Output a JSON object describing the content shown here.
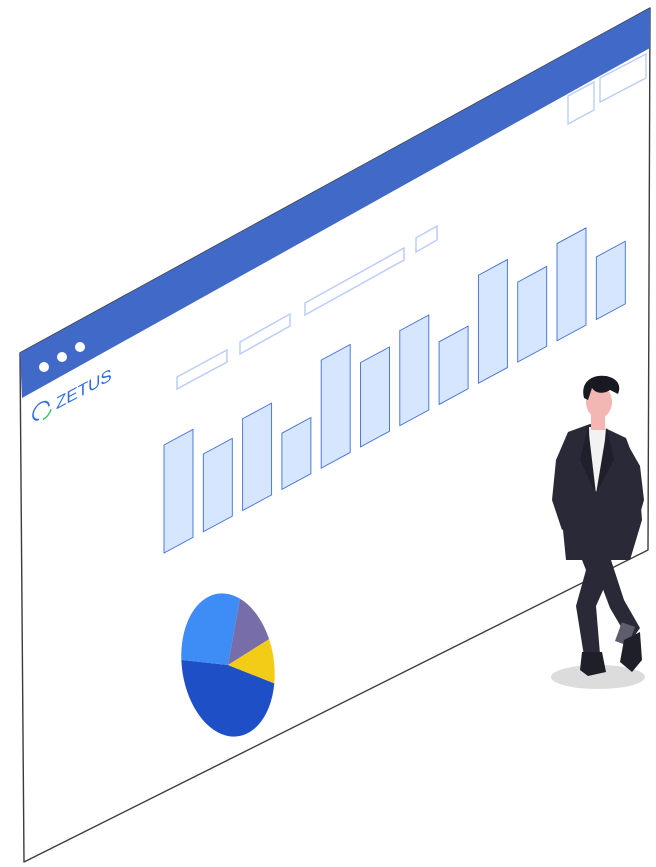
{
  "window": {
    "brand": {
      "name": "ZETUS",
      "color": "#2f6de0",
      "accent_color": "#27c25c"
    },
    "title_bar_color": "#4169c8",
    "frame_color": "#3b3b3b",
    "window_controls": [
      "dot",
      "dot",
      "dot"
    ]
  },
  "dashboard": {
    "placeholder_color": "#bccef8",
    "bar_fill_color": "#d6e6ff",
    "bar_stroke_color": "#3e6fd8",
    "bar_levels": [
      1.0,
      0.72,
      0.85,
      0.52,
      1.0,
      0.78,
      0.88,
      0.58,
      1.0,
      0.74,
      0.9,
      0.58
    ],
    "pie_colors": [
      "#1f4fc7",
      "#3e8cf5",
      "#776da9",
      "#f3cc17"
    ],
    "pie_shares": [
      0.47,
      0.3,
      0.13,
      0.1
    ]
  },
  "illustration": {
    "person": "businessman-standing",
    "suit_color": "#2a2938",
    "skin_color": "#f4b6b3",
    "hair_color": "#191922",
    "shadow_color": "#dcdcdc"
  }
}
